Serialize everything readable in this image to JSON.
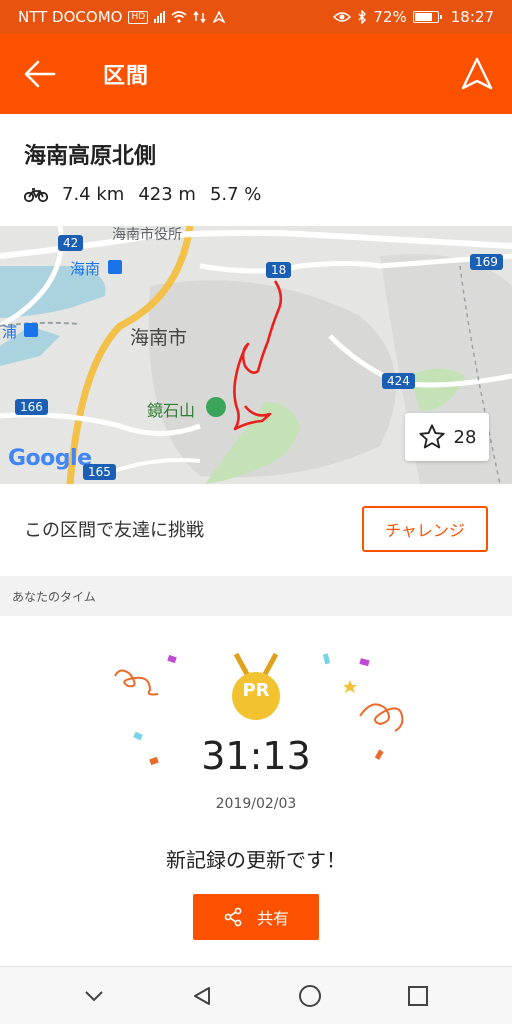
{
  "status_bar": {
    "carrier": "NTT DOCOMO",
    "hd_badge": "HD",
    "battery": "72%",
    "time": "18:27",
    "battery_level": 0.72
  },
  "app_bar": {
    "title": "区間",
    "back_icon": "arrow-left-icon",
    "nav_icon": "navigation-arrow-icon"
  },
  "segment": {
    "name": "海南高原北側",
    "activity_icon": "bike-icon",
    "distance": "7.4 km",
    "elevation": "423 m",
    "grade": "5.7 %"
  },
  "map": {
    "labels": {
      "city_hall": "海南市役所",
      "station_kainan": "海南",
      "station_ura": "浦",
      "city": "海南市",
      "mountain": "鏡石山",
      "google": "Google"
    },
    "routes": {
      "r42": "42",
      "r18": "18",
      "r169": "169",
      "r424": "424",
      "r166": "166",
      "r165": "165"
    },
    "route_color": "#e8201e",
    "star_count": "28"
  },
  "challenge": {
    "text": "この区間で友達に挑戦",
    "button": "チャレンジ"
  },
  "your_time": {
    "label": "あなたのタイム",
    "badge": "PR",
    "time": "31:13",
    "date": "2019/02/03",
    "message": "新記録の更新です！",
    "share_button": "共有"
  },
  "colors": {
    "accent": "#fc5200",
    "status_bar": "#e8530f",
    "medal": "#f2c230"
  }
}
